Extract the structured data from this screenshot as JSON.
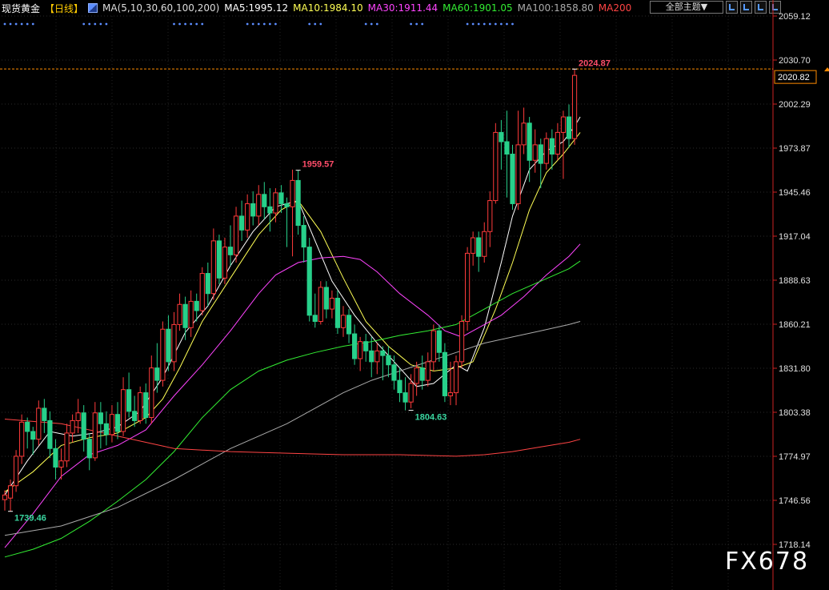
{
  "header": {
    "title": "现货黄金",
    "period": "【日线】",
    "ma_params": "MA(5,10,30,60,100,200)",
    "ma5": "MA5:1995.12",
    "ma10": "MA10:1984.10",
    "ma30": "MA30:1911.44",
    "ma60": "MA60:1901.05",
    "ma100": "MA100:1858.80",
    "ma200": "MA200"
  },
  "toolbar": {
    "theme_label": "全部主题▼"
  },
  "watermark": "FX678",
  "colors": {
    "up": "#ff3b3b",
    "down": "#27d08a",
    "ma5": "#ffffff",
    "ma10": "#ffff55",
    "ma30": "#ff44ff",
    "ma60": "#33ee33",
    "ma100": "#aaaaaa",
    "ma200": "#ff4444",
    "axis": "#cc2222",
    "price_line": "#ff8c00"
  },
  "chart_data": {
    "type": "candlestick",
    "ylim": [
      1709,
      2070
    ],
    "y_ticks": [
      "2059.12",
      "2030.70",
      "2002.29",
      "1973.87",
      "1945.46",
      "1917.04",
      "1888.63",
      "1860.21",
      "1831.80",
      "1803.38",
      "1774.97",
      "1746.56",
      "1718.14"
    ],
    "current_price": "2020.82",
    "annotations": [
      {
        "label": "1739.46",
        "index": 1,
        "value": 1739.46,
        "kind": "low"
      },
      {
        "label": "1959.57",
        "index": 52,
        "value": 1959.57,
        "kind": "high"
      },
      {
        "label": "1804.63",
        "index": 72,
        "value": 1804.63,
        "kind": "low"
      },
      {
        "label": "2024.87",
        "index": 101,
        "value": 2024.87,
        "kind": "high"
      }
    ],
    "candles": [
      [
        1747,
        1750,
        1740,
        1753
      ],
      [
        1748,
        1756,
        1739.46,
        1760
      ],
      [
        1756,
        1775,
        1752,
        1779
      ],
      [
        1775,
        1797,
        1770,
        1802
      ],
      [
        1797,
        1791,
        1780,
        1800
      ],
      [
        1791,
        1786,
        1776,
        1794
      ],
      [
        1786,
        1806,
        1782,
        1811
      ],
      [
        1806,
        1798,
        1790,
        1812
      ],
      [
        1798,
        1780,
        1774,
        1804
      ],
      [
        1780,
        1768,
        1760,
        1786
      ],
      [
        1768,
        1772,
        1760,
        1780
      ],
      [
        1772,
        1790,
        1768,
        1796
      ],
      [
        1790,
        1798,
        1784,
        1802
      ],
      [
        1798,
        1803,
        1790,
        1812
      ],
      [
        1803,
        1786,
        1778,
        1808
      ],
      [
        1786,
        1774,
        1766,
        1790
      ],
      [
        1774,
        1803,
        1772,
        1810
      ],
      [
        1803,
        1796,
        1780,
        1810
      ],
      [
        1796,
        1789,
        1782,
        1804
      ],
      [
        1789,
        1802,
        1784,
        1808
      ],
      [
        1802,
        1791,
        1786,
        1810
      ],
      [
        1791,
        1818,
        1788,
        1826
      ],
      [
        1818,
        1804,
        1800,
        1829
      ],
      [
        1804,
        1798,
        1794,
        1814
      ],
      [
        1798,
        1816,
        1796,
        1820
      ],
      [
        1816,
        1800,
        1796,
        1822
      ],
      [
        1800,
        1832,
        1796,
        1840
      ],
      [
        1832,
        1824,
        1816,
        1848
      ],
      [
        1824,
        1857,
        1820,
        1862
      ],
      [
        1857,
        1836,
        1830,
        1866
      ],
      [
        1836,
        1860,
        1830,
        1868
      ],
      [
        1860,
        1873,
        1856,
        1880
      ],
      [
        1873,
        1858,
        1850,
        1878
      ],
      [
        1858,
        1875,
        1852,
        1882
      ],
      [
        1875,
        1869,
        1862,
        1880
      ],
      [
        1869,
        1893,
        1866,
        1897
      ],
      [
        1893,
        1880,
        1872,
        1900
      ],
      [
        1880,
        1914,
        1876,
        1922
      ],
      [
        1914,
        1890,
        1886,
        1918
      ],
      [
        1890,
        1910,
        1886,
        1916
      ],
      [
        1910,
        1905,
        1898,
        1924
      ],
      [
        1905,
        1930,
        1900,
        1936
      ],
      [
        1930,
        1921,
        1914,
        1940
      ],
      [
        1921,
        1938,
        1916,
        1944
      ],
      [
        1938,
        1930,
        1924,
        1946
      ],
      [
        1930,
        1944,
        1924,
        1950
      ],
      [
        1944,
        1936,
        1928,
        1952
      ],
      [
        1936,
        1932,
        1920,
        1948
      ],
      [
        1932,
        1945,
        1926,
        1948
      ],
      [
        1945,
        1938,
        1932,
        1950
      ],
      [
        1938,
        1936,
        1910,
        1942
      ],
      [
        1936,
        1953,
        1904,
        1960
      ],
      [
        1953,
        1924,
        1918,
        1959.57
      ],
      [
        1924,
        1910,
        1900,
        1930
      ],
      [
        1910,
        1866,
        1862,
        1916
      ],
      [
        1866,
        1862,
        1858,
        1880
      ],
      [
        1862,
        1884,
        1860,
        1888
      ],
      [
        1884,
        1870,
        1864,
        1888
      ],
      [
        1870,
        1877,
        1864,
        1882
      ],
      [
        1877,
        1858,
        1854,
        1882
      ],
      [
        1858,
        1866,
        1852,
        1872
      ],
      [
        1866,
        1854,
        1848,
        1870
      ],
      [
        1854,
        1838,
        1834,
        1860
      ],
      [
        1838,
        1849,
        1830,
        1852
      ],
      [
        1849,
        1843,
        1836,
        1854
      ],
      [
        1843,
        1836,
        1826,
        1852
      ],
      [
        1836,
        1843,
        1828,
        1848
      ],
      [
        1843,
        1840,
        1824,
        1846
      ],
      [
        1840,
        1834,
        1826,
        1846
      ],
      [
        1834,
        1824,
        1818,
        1840
      ],
      [
        1824,
        1816,
        1810,
        1832
      ],
      [
        1816,
        1810,
        1804.63,
        1826
      ],
      [
        1810,
        1822,
        1806,
        1828
      ],
      [
        1822,
        1832,
        1814,
        1836
      ],
      [
        1832,
        1824,
        1818,
        1840
      ],
      [
        1824,
        1836,
        1820,
        1842
      ],
      [
        1836,
        1856,
        1830,
        1860
      ],
      [
        1856,
        1842,
        1836,
        1860
      ],
      [
        1842,
        1814,
        1810,
        1848
      ],
      [
        1814,
        1816,
        1808,
        1836
      ],
      [
        1816,
        1836,
        1808,
        1840
      ],
      [
        1836,
        1862,
        1832,
        1866
      ],
      [
        1862,
        1906,
        1856,
        1910
      ],
      [
        1906,
        1916,
        1898,
        1920
      ],
      [
        1916,
        1904,
        1894,
        1920
      ],
      [
        1904,
        1920,
        1900,
        1926
      ],
      [
        1920,
        1940,
        1910,
        1946
      ],
      [
        1940,
        1984,
        1938,
        1990
      ],
      [
        1984,
        1978,
        1960,
        1992
      ],
      [
        1978,
        1970,
        1942,
        1998
      ],
      [
        1970,
        1938,
        1934,
        1976
      ],
      [
        1938,
        1976,
        1934,
        1998
      ],
      [
        1976,
        1990,
        1970,
        2000
      ],
      [
        1990,
        1966,
        1952,
        1994
      ],
      [
        1966,
        1976,
        1958,
        1986
      ],
      [
        1976,
        1964,
        1948,
        1980
      ],
      [
        1964,
        1980,
        1960,
        1984
      ],
      [
        1980,
        1970,
        1960,
        1986
      ],
      [
        1970,
        1984,
        1966,
        1990
      ],
      [
        1984,
        1994,
        1954,
        1998
      ],
      [
        1994,
        1980,
        1974,
        2002
      ],
      [
        1980,
        2020.82,
        1976,
        2024.87
      ]
    ],
    "ma_series": [
      {
        "name": "MA5",
        "color_key": "ma5",
        "points": [
          [
            0,
            1750
          ],
          [
            4,
            1772
          ],
          [
            8,
            1791
          ],
          [
            12,
            1788
          ],
          [
            16,
            1790
          ],
          [
            20,
            1794
          ],
          [
            24,
            1804
          ],
          [
            28,
            1826
          ],
          [
            32,
            1855
          ],
          [
            36,
            1872
          ],
          [
            40,
            1898
          ],
          [
            44,
            1920
          ],
          [
            48,
            1936
          ],
          [
            52,
            1940
          ],
          [
            55,
            1914
          ],
          [
            58,
            1888
          ],
          [
            62,
            1866
          ],
          [
            66,
            1848
          ],
          [
            70,
            1832
          ],
          [
            73,
            1820
          ],
          [
            76,
            1822
          ],
          [
            80,
            1834
          ],
          [
            82,
            1830
          ],
          [
            85,
            1858
          ],
          [
            88,
            1900
          ],
          [
            90,
            1930
          ],
          [
            93,
            1960
          ],
          [
            96,
            1972
          ],
          [
            99,
            1978
          ],
          [
            101,
            1988
          ],
          [
            102,
            1994
          ]
        ]
      },
      {
        "name": "MA10",
        "color_key": "ma10",
        "points": [
          [
            0,
            1752
          ],
          [
            5,
            1765
          ],
          [
            10,
            1782
          ],
          [
            15,
            1787
          ],
          [
            20,
            1790
          ],
          [
            25,
            1800
          ],
          [
            28,
            1812
          ],
          [
            31,
            1832
          ],
          [
            35,
            1862
          ],
          [
            40,
            1890
          ],
          [
            45,
            1918
          ],
          [
            49,
            1934
          ],
          [
            52,
            1940
          ],
          [
            56,
            1920
          ],
          [
            60,
            1890
          ],
          [
            64,
            1862
          ],
          [
            68,
            1846
          ],
          [
            72,
            1834
          ],
          [
            76,
            1830
          ],
          [
            80,
            1832
          ],
          [
            83,
            1836
          ],
          [
            87,
            1870
          ],
          [
            90,
            1900
          ],
          [
            93,
            1934
          ],
          [
            96,
            1958
          ],
          [
            99,
            1970
          ],
          [
            102,
            1984
          ]
        ]
      },
      {
        "name": "MA30",
        "color_key": "ma30",
        "points": [
          [
            0,
            1716
          ],
          [
            5,
            1738
          ],
          [
            10,
            1762
          ],
          [
            15,
            1776
          ],
          [
            20,
            1782
          ],
          [
            25,
            1792
          ],
          [
            30,
            1814
          ],
          [
            35,
            1834
          ],
          [
            40,
            1856
          ],
          [
            45,
            1880
          ],
          [
            48,
            1892
          ],
          [
            52,
            1900
          ],
          [
            56,
            1903
          ],
          [
            60,
            1904
          ],
          [
            63,
            1902
          ],
          [
            66,
            1894
          ],
          [
            70,
            1880
          ],
          [
            75,
            1866
          ],
          [
            78,
            1856
          ],
          [
            81,
            1852
          ],
          [
            84,
            1858
          ],
          [
            88,
            1866
          ],
          [
            92,
            1878
          ],
          [
            96,
            1892
          ],
          [
            100,
            1904
          ],
          [
            102,
            1912
          ]
        ]
      },
      {
        "name": "MA60",
        "color_key": "ma60",
        "points": [
          [
            0,
            1710
          ],
          [
            5,
            1715
          ],
          [
            10,
            1722
          ],
          [
            15,
            1733
          ],
          [
            20,
            1746
          ],
          [
            25,
            1760
          ],
          [
            30,
            1778
          ],
          [
            35,
            1800
          ],
          [
            40,
            1818
          ],
          [
            45,
            1830
          ],
          [
            50,
            1837
          ],
          [
            55,
            1842
          ],
          [
            60,
            1846
          ],
          [
            65,
            1849
          ],
          [
            70,
            1853
          ],
          [
            75,
            1856
          ],
          [
            80,
            1860
          ],
          [
            85,
            1870
          ],
          [
            90,
            1880
          ],
          [
            95,
            1888
          ],
          [
            100,
            1896
          ],
          [
            102,
            1901
          ]
        ]
      },
      {
        "name": "MA100",
        "color_key": "ma100",
        "points": [
          [
            0,
            1724
          ],
          [
            10,
            1730
          ],
          [
            20,
            1742
          ],
          [
            30,
            1760
          ],
          [
            40,
            1780
          ],
          [
            50,
            1796
          ],
          [
            55,
            1806
          ],
          [
            60,
            1816
          ],
          [
            65,
            1824
          ],
          [
            70,
            1830
          ],
          [
            75,
            1836
          ],
          [
            80,
            1842
          ],
          [
            85,
            1848
          ],
          [
            90,
            1852
          ],
          [
            95,
            1856
          ],
          [
            100,
            1860
          ],
          [
            102,
            1862
          ]
        ]
      },
      {
        "name": "MA200",
        "color_key": "ma200",
        "points": [
          [
            0,
            1799
          ],
          [
            10,
            1796
          ],
          [
            20,
            1788
          ],
          [
            30,
            1780
          ],
          [
            40,
            1778
          ],
          [
            50,
            1777
          ],
          [
            60,
            1776
          ],
          [
            70,
            1776
          ],
          [
            80,
            1775
          ],
          [
            85,
            1776
          ],
          [
            90,
            1778
          ],
          [
            95,
            1781
          ],
          [
            100,
            1784
          ],
          [
            102,
            1786
          ]
        ]
      }
    ],
    "marker_dot_groups": [
      [
        0,
        5
      ],
      [
        14,
        18
      ],
      [
        30,
        35
      ],
      [
        43,
        48
      ],
      [
        54,
        56
      ],
      [
        64,
        66
      ],
      [
        72,
        74
      ],
      [
        82,
        90
      ]
    ]
  }
}
